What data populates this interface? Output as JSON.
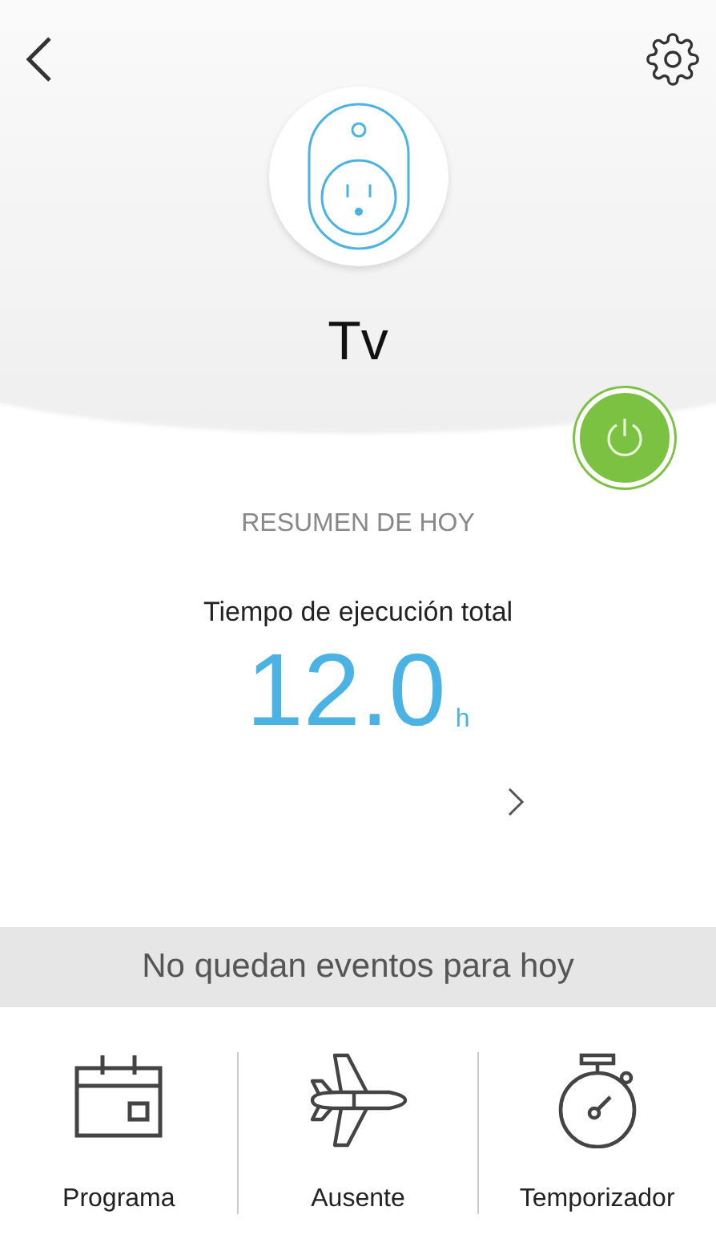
{
  "device": {
    "name": "Tv",
    "power_on": true
  },
  "summary": {
    "title": "RESUMEN DE HOY",
    "label": "Tiempo de ejecución total",
    "value": "12.0",
    "unit": "h"
  },
  "events": {
    "message": "No quedan eventos para hoy"
  },
  "actions": [
    {
      "kind": "schedule",
      "label": "Programa"
    },
    {
      "kind": "away",
      "label": "Ausente"
    },
    {
      "kind": "timer",
      "label": "Temporizador"
    }
  ]
}
